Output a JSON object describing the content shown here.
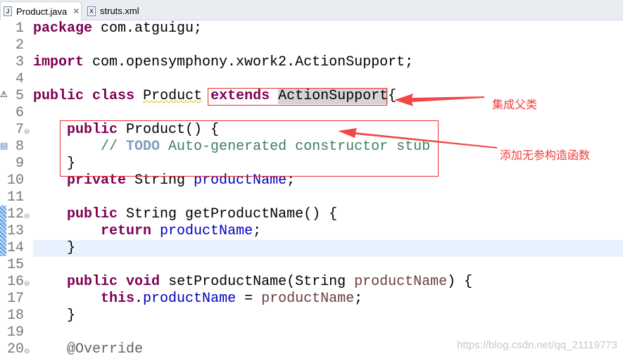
{
  "tabs": [
    {
      "label": "Product.java",
      "icon": "J",
      "active": true,
      "close": "✕"
    },
    {
      "label": "struts.xml",
      "icon": "X",
      "active": false
    }
  ],
  "code": [
    {
      "n": "1",
      "tokens": [
        [
          "package",
          "kw"
        ],
        [
          " com.atguigu;",
          ""
        ]
      ]
    },
    {
      "n": "2",
      "tokens": []
    },
    {
      "n": "3",
      "tokens": [
        [
          "import",
          "kw"
        ],
        [
          " com.opensymphony.xwork2.ActionSupport;",
          ""
        ]
      ]
    },
    {
      "n": "4",
      "tokens": []
    },
    {
      "n": "5",
      "tokens": [
        [
          "public",
          "kw"
        ],
        [
          " ",
          ""
        ],
        [
          "class",
          "kw"
        ],
        [
          " ",
          ""
        ],
        [
          "Product",
          "squig"
        ],
        [
          " ",
          ""
        ],
        [
          "extends",
          "kw"
        ],
        [
          " ",
          ""
        ],
        [
          "ActionSupport",
          "hl"
        ],
        [
          "{",
          ""
        ]
      ]
    },
    {
      "n": "6",
      "tokens": []
    },
    {
      "n": "7",
      "fold": true,
      "tokens": [
        [
          "    ",
          ""
        ],
        [
          "public",
          "kw"
        ],
        [
          " Product() {",
          ""
        ]
      ]
    },
    {
      "n": "8",
      "tokens": [
        [
          "        // ",
          "cmt"
        ],
        [
          "TODO",
          "todo"
        ],
        [
          " Auto-generated constructor stub",
          "cmt"
        ]
      ]
    },
    {
      "n": "9",
      "tokens": [
        [
          "    }",
          ""
        ]
      ]
    },
    {
      "n": "10",
      "tokens": [
        [
          "    ",
          ""
        ],
        [
          "private",
          "kw"
        ],
        [
          " String ",
          ""
        ],
        [
          "productName",
          "fld"
        ],
        [
          ";",
          ""
        ]
      ]
    },
    {
      "n": "11",
      "tokens": []
    },
    {
      "n": "12",
      "fold": true,
      "tokens": [
        [
          "    ",
          ""
        ],
        [
          "public",
          "kw"
        ],
        [
          " String getProductName() {",
          ""
        ]
      ]
    },
    {
      "n": "13",
      "tokens": [
        [
          "        ",
          ""
        ],
        [
          "return",
          "kw"
        ],
        [
          " ",
          ""
        ],
        [
          "productName",
          "fld"
        ],
        [
          ";",
          ""
        ]
      ]
    },
    {
      "n": "14",
      "current": true,
      "tokens": [
        [
          "    }",
          ""
        ]
      ]
    },
    {
      "n": "15",
      "tokens": []
    },
    {
      "n": "16",
      "fold": true,
      "tokens": [
        [
          "    ",
          ""
        ],
        [
          "public",
          "kw"
        ],
        [
          " ",
          ""
        ],
        [
          "void",
          "kw"
        ],
        [
          " setProductName(String ",
          ""
        ],
        [
          "productName",
          "par"
        ],
        [
          ") {",
          ""
        ]
      ]
    },
    {
      "n": "17",
      "tokens": [
        [
          "        ",
          ""
        ],
        [
          "this",
          "kw"
        ],
        [
          ".",
          ""
        ],
        [
          "productName",
          "fld"
        ],
        [
          " = ",
          ""
        ],
        [
          "productName",
          "par"
        ],
        [
          ";",
          ""
        ]
      ]
    },
    {
      "n": "18",
      "tokens": [
        [
          "    }",
          ""
        ]
      ]
    },
    {
      "n": "19",
      "tokens": []
    },
    {
      "n": "20",
      "fold": true,
      "tokens": [
        [
          "    ",
          ""
        ],
        [
          "@Override",
          "ann"
        ]
      ]
    }
  ],
  "annotations": {
    "extends_note": "集成父类",
    "constructor_note": "添加无参构造函数",
    "color": "#e8312f"
  },
  "watermark": "https://blog.csdn.net/qq_21119773"
}
